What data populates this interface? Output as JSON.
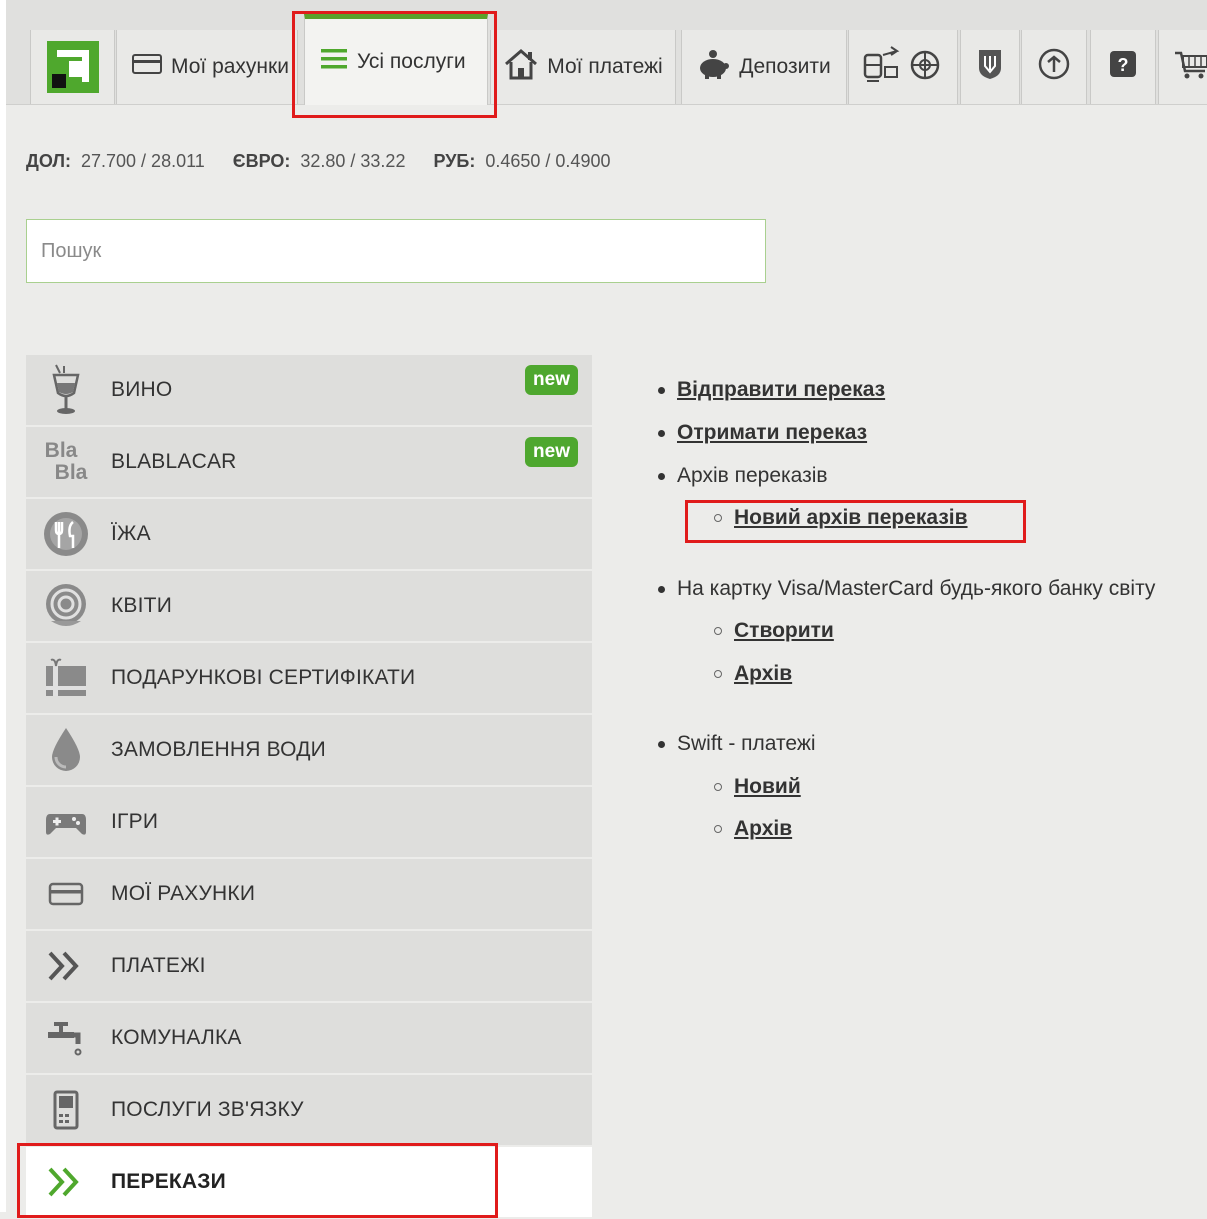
{
  "nav": {
    "tabs": [
      {
        "label": "Мої рахунки",
        "icon": "card-icon"
      },
      {
        "label": "Усі послуги",
        "icon": "list-icon",
        "active": true
      },
      {
        "label": "Мої платежі",
        "icon": "house-icon"
      },
      {
        "label": "Депозити",
        "icon": "piggy-bank-icon"
      }
    ],
    "icon_tabs": [
      "travel-icon",
      "ukraine-coat-of-arms-icon",
      "history-icon",
      "help-icon",
      "cart-icon"
    ]
  },
  "rates": [
    {
      "label": "ДОЛ:",
      "value": "27.700 / 28.011"
    },
    {
      "label": "ЄВРО:",
      "value": "32.80 / 33.22"
    },
    {
      "label": "РУБ:",
      "value": "0.4650 / 0.4900"
    }
  ],
  "search": {
    "placeholder": "Пошук"
  },
  "categories": [
    {
      "label": "ВИНО",
      "icon": "wine-glass-icon",
      "badge": "new"
    },
    {
      "label": "BLABLACAR",
      "icon": "blablacar-icon",
      "badge": "new",
      "icon_text": [
        "Bla",
        "Bla"
      ]
    },
    {
      "label": "ЇЖА",
      "icon": "food-icon"
    },
    {
      "label": "КВІТИ",
      "icon": "flower-icon"
    },
    {
      "label": "ПОДАРУНКОВІ СЕРТИФІКАТИ",
      "icon": "gift-card-icon"
    },
    {
      "label": "ЗАМОВЛЕННЯ ВОДИ",
      "icon": "water-drop-icon"
    },
    {
      "label": "ІГРИ",
      "icon": "gamepad-icon"
    },
    {
      "label": "МОЇ РАХУНКИ",
      "icon": "card-icon"
    },
    {
      "label": "ПЛАТЕЖІ",
      "icon": "chevrons-icon"
    },
    {
      "label": "КОМУНАЛКА",
      "icon": "faucet-icon"
    },
    {
      "label": "ПОСЛУГИ ЗВ'ЯЗКУ",
      "icon": "phone-icon"
    },
    {
      "label": "ПЕРЕКАЗИ",
      "icon": "chevrons-green-icon",
      "active": true
    }
  ],
  "menu": {
    "send": "Відправити переказ",
    "receive": "Отримати переказ",
    "archive": "Архів переказів",
    "new_archive": "Новий архів переказів",
    "card": "На картку Visa/MasterCard будь-якого банку світу",
    "card_create": "Створити",
    "card_archive": "Архів",
    "swift": "Swift - платежі",
    "swift_new": "Новий",
    "swift_archive": "Архів"
  },
  "colors": {
    "accent": "#4fa82d",
    "highlight": "#e01b1b"
  }
}
